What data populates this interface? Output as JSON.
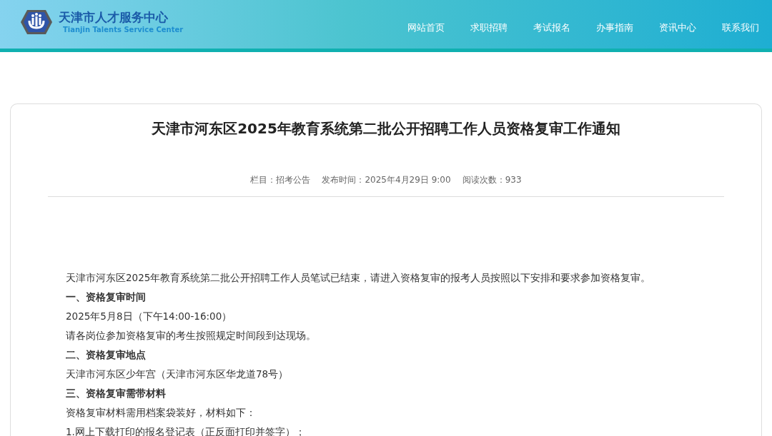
{
  "header": {
    "logo_title": "天津市人才服务中心",
    "logo_subtitle": "Tianjin Talents Service Center",
    "nav": [
      {
        "label": "网站首页"
      },
      {
        "label": "求职招聘"
      },
      {
        "label": "考试报名"
      },
      {
        "label": "办事指南"
      },
      {
        "label": "资讯中心"
      },
      {
        "label": "联系我们"
      }
    ]
  },
  "article": {
    "title": "天津市河东区2025年教育系统第二批公开招聘工作人员资格复审工作通知",
    "meta": [
      "栏目：招考公告",
      "发布时间：2025年4月29日 9:00",
      "阅读次数：933"
    ],
    "paragraphs": [
      {
        "kind": "text",
        "text": "天津市河东区2025年教育系统第二批公开招聘工作人员笔试已结束，请进入资格复审的报考人员按照以下安排和要求参加资格复审。"
      },
      {
        "kind": "heading",
        "text": "一、资格复审时间"
      },
      {
        "kind": "text",
        "text": "2025年5月8日（下午14:00-16:00）"
      },
      {
        "kind": "text",
        "text": "请各岗位参加资格复审的考生按照规定时间段到达现场。"
      },
      {
        "kind": "heading",
        "text": "二、资格复审地点"
      },
      {
        "kind": "text",
        "text": "天津市河东区少年宫（天津市河东区华龙道78号）"
      },
      {
        "kind": "heading",
        "text": "三、资格复审需带材料"
      },
      {
        "kind": "text",
        "text": "资格复审材料需用档案袋装好，材料如下："
      },
      {
        "kind": "text",
        "text": "1.网上下载打印的报名登记表（正反面打印并签字）；"
      }
    ]
  }
}
